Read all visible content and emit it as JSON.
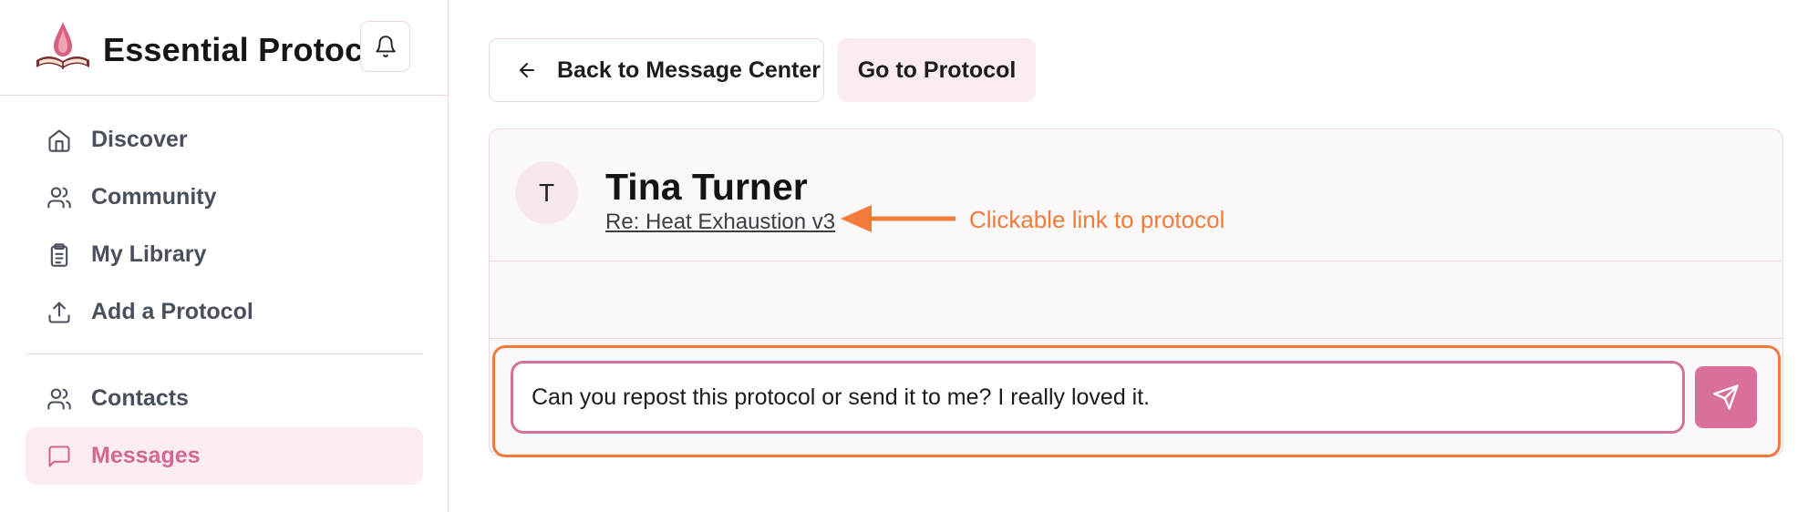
{
  "brand": {
    "title": "Essential Protocol",
    "logo_icon": "book-drop-logo"
  },
  "sidebar": {
    "items": [
      {
        "label": "Discover",
        "icon": "home-icon",
        "active": false
      },
      {
        "label": "Community",
        "icon": "users-icon",
        "active": false
      },
      {
        "label": "My Library",
        "icon": "clipboard-icon",
        "active": false
      },
      {
        "label": "Add a Protocol",
        "icon": "upload-icon",
        "active": false
      }
    ],
    "items_secondary": [
      {
        "label": "Contacts",
        "icon": "users-icon",
        "active": false
      },
      {
        "label": "Messages",
        "icon": "message-square-icon",
        "active": true
      }
    ]
  },
  "toolbar": {
    "back_label": "Back to Message Center",
    "go_label": "Go to Protocol"
  },
  "conversation": {
    "avatar_initial": "T",
    "contact_name": "Tina Turner",
    "subject": "Re: Heat Exhaustion v3"
  },
  "composer": {
    "value": "Can you repost this protocol or send it to me? I really loved it."
  },
  "annotation": {
    "text": "Clickable link to protocol"
  },
  "colors": {
    "accent": "#d9709a",
    "accent_light": "#fbecf2",
    "annotation": "#f27a3a",
    "border": "#f0d6de"
  }
}
